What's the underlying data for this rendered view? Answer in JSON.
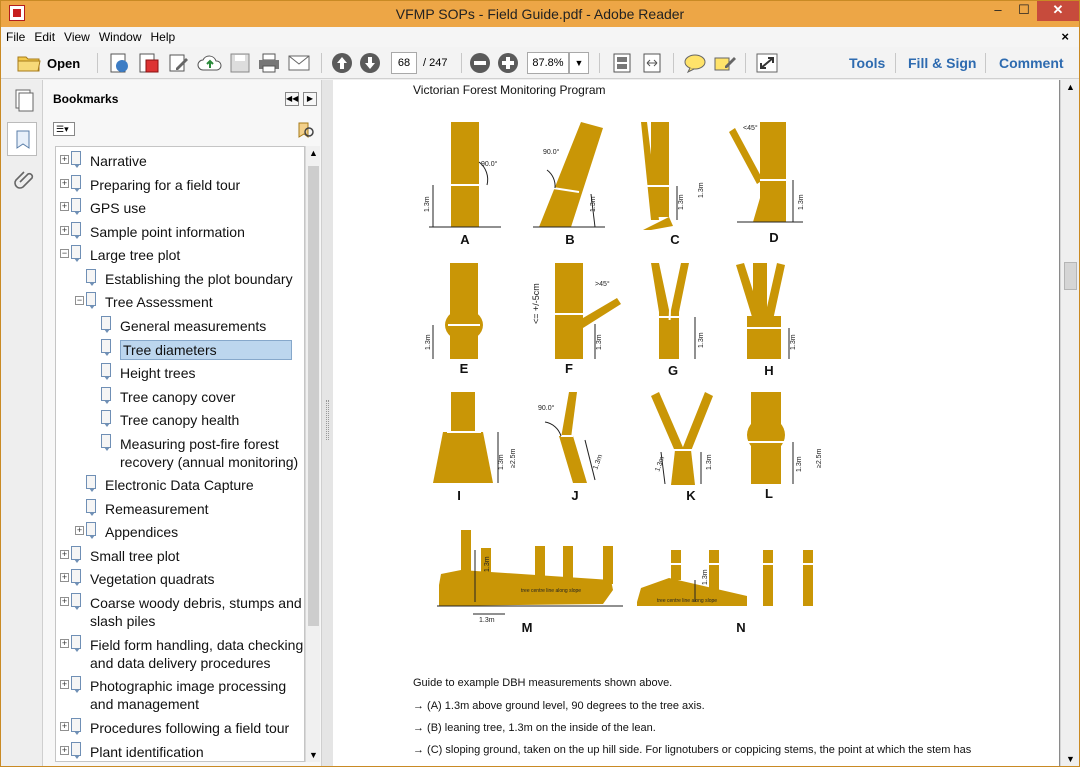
{
  "window": {
    "title": "VFMP SOPs - Field Guide.pdf - Adobe Reader",
    "min": "–",
    "max": "☐",
    "close": "✕"
  },
  "menu": {
    "items": [
      "File",
      "Edit",
      "View",
      "Window",
      "Help"
    ],
    "close_doc": "×"
  },
  "toolbar": {
    "open_label": "Open",
    "page_current": "68",
    "page_total": "/ 247",
    "zoom": "87.8%",
    "tools": "Tools",
    "fill_sign": "Fill & Sign",
    "comment": "Comment"
  },
  "bookmarks": {
    "title": "Bookmarks",
    "items": [
      {
        "label": "Narrative",
        "expander": "+"
      },
      {
        "label": "Preparing for a field tour",
        "expander": "+"
      },
      {
        "label": "GPS use",
        "expander": "+"
      },
      {
        "label": "Sample point information",
        "expander": "+"
      },
      {
        "label": "Large tree plot",
        "expander": "−"
      },
      {
        "label": "Establishing the plot boundary",
        "expander": ""
      },
      {
        "label": "Tree Assessment",
        "expander": "−"
      },
      {
        "label": "General measurements",
        "expander": ""
      },
      {
        "label": "Tree diameters",
        "expander": ""
      },
      {
        "label": "Height trees",
        "expander": ""
      },
      {
        "label": "Tree canopy cover",
        "expander": ""
      },
      {
        "label": "Tree canopy health",
        "expander": ""
      },
      {
        "label": "Measuring post-fire forest",
        "label2": "recovery (annual monitoring)",
        "expander": ""
      },
      {
        "label": "Electronic Data Capture",
        "expander": ""
      },
      {
        "label": "Remeasurement",
        "expander": ""
      },
      {
        "label": "Appendices",
        "expander": "+"
      },
      {
        "label": "Small tree plot",
        "expander": "+"
      },
      {
        "label": "Vegetation quadrats",
        "expander": "+"
      },
      {
        "label": "Coarse woody debris, stumps and",
        "label2": "slash piles",
        "expander": "+"
      },
      {
        "label": "Field form handling, data checking",
        "label2": "and data delivery procedures",
        "expander": "+"
      },
      {
        "label": "Photographic image processing",
        "label2": "and management",
        "expander": "+"
      },
      {
        "label": "Procedures following a field tour",
        "expander": "+"
      },
      {
        "label": "Plant identification",
        "expander": "+"
      }
    ]
  },
  "document": {
    "header": "Victorian Forest Monitoring Program",
    "figure_labels": [
      "A",
      "B",
      "C",
      "D",
      "E",
      "F",
      "G",
      "H",
      "I",
      "J",
      "K",
      "L",
      "M",
      "N"
    ],
    "fig_annotations": {
      "a_angle": "90.0°",
      "b_angle": "90.0°",
      "d_angle": "<45°",
      "f_angle": ">45°",
      "j_angle": "90.0°",
      "h13": "1.3m",
      "h25": "≥2.5m",
      "f_side": "<= +/-5cm",
      "m_base": "1.3m",
      "m_ground": "tree centre line along slope",
      "n_ground": "tree centre line along slope"
    },
    "guide_title": "Guide to example DBH measurements shown above.",
    "lines": [
      "→ (A) 1.3m above ground level, 90 degrees to the tree axis.",
      "→ (B) leaning tree, 1.3m on the inside of the lean.",
      "→ (C) sloping ground, taken on the up hill side.  For lignotubers or coppicing stems, the point at which the stem has"
    ]
  },
  "colors": {
    "title_bar": "#eda646",
    "tree": "#c99606",
    "selection": "#bcd6ee",
    "link": "#2e6bb0"
  }
}
